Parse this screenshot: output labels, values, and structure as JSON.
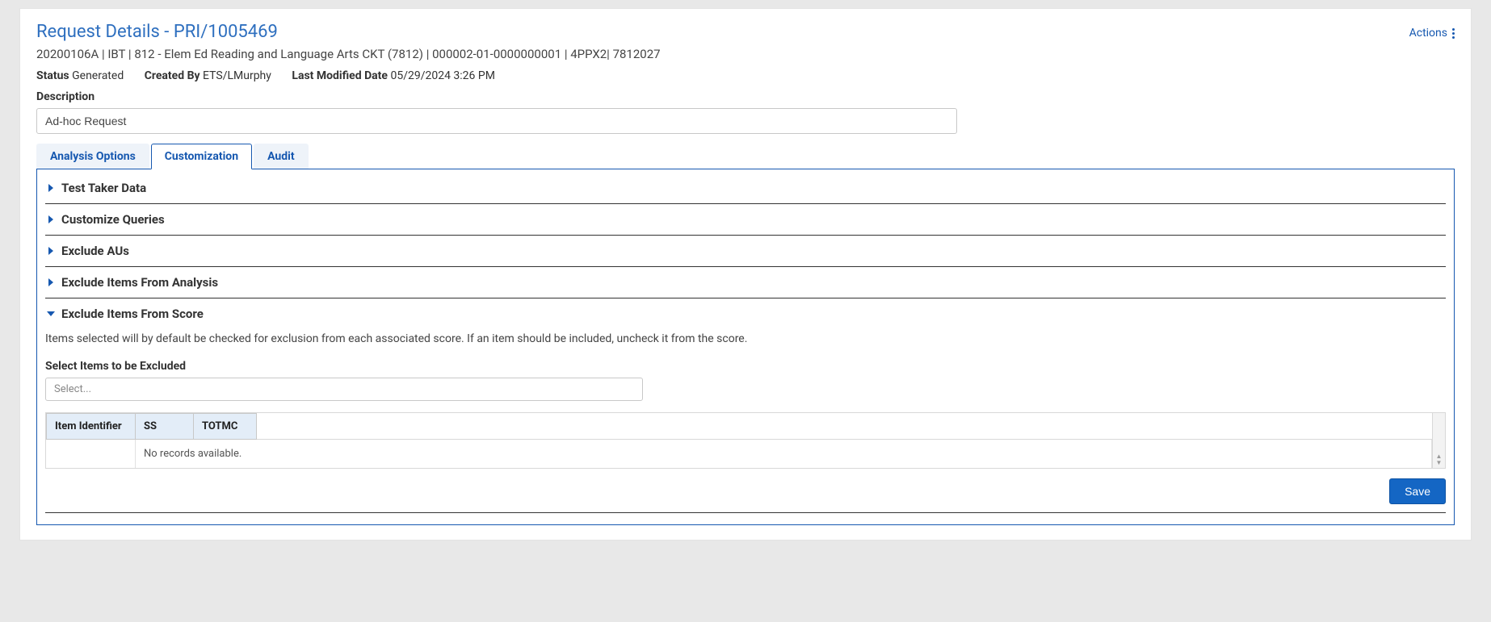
{
  "header": {
    "title": "Request Details - PRI/1005469",
    "actions_label": "Actions",
    "breadcrumb": "20200106A | IBT | 812 - Elem Ed Reading and Language Arts CKT (7812) | 000002-01-0000000001 | 4PPX2| 7812027"
  },
  "meta": {
    "status_label": "Status",
    "status_value": "Generated",
    "created_by_label": "Created By",
    "created_by_value": "ETS/LMurphy",
    "last_modified_label": "Last Modified Date",
    "last_modified_value": "05/29/2024 3:26 PM"
  },
  "description": {
    "label": "Description",
    "value": "Ad-hoc Request"
  },
  "tabs": {
    "analysis_options": "Analysis Options",
    "customization": "Customization",
    "audit": "Audit"
  },
  "accordions": {
    "test_taker_data": "Test Taker Data",
    "customize_queries": "Customize Queries",
    "exclude_aus": "Exclude AUs",
    "exclude_items_analysis": "Exclude Items From Analysis",
    "exclude_items_score": "Exclude Items From Score"
  },
  "exclude_score_panel": {
    "help_text": "Items selected will by default be checked for exclusion from each associated score. If an item should be included, uncheck it from the score.",
    "select_label": "Select Items to be Excluded",
    "select_placeholder": "Select...",
    "grid": {
      "columns": [
        "Item Identifier",
        "SS",
        "TOTMC"
      ],
      "no_records": "No records available."
    }
  },
  "footer": {
    "save": "Save"
  }
}
